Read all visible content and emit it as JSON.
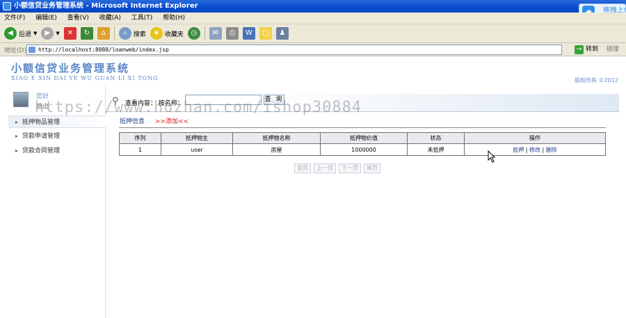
{
  "window": {
    "title": "小额信贷业务管理系统 - Microsoft Internet Explorer"
  },
  "upload_widget": {
    "label": "拖拽上传"
  },
  "menu": [
    "文件(F)",
    "编辑(E)",
    "查看(V)",
    "收藏(A)",
    "工具(T)",
    "帮助(H)"
  ],
  "toolbar": {
    "back": "后退",
    "search": "搜索",
    "favorites": "收藏夹"
  },
  "addressbar": {
    "label": "地址(D)",
    "url": "http://localhost:8088/loanweb/index.jsp",
    "go": "转到",
    "links": "链接"
  },
  "header": {
    "title": "小额信贷业务管理系统",
    "pinyin": "XIAO E XIN DAI YE WU GUAN LI XI TONG",
    "copyright": "版权所有  ©2012"
  },
  "user": {
    "greeting": "您好",
    "exit": "退出"
  },
  "sidebar": {
    "items": [
      {
        "label": "抵押物品管理"
      },
      {
        "label": "贷款申请管理"
      },
      {
        "label": "贷款合同管理"
      }
    ]
  },
  "search": {
    "label": "查看内容：  按名称：",
    "value": "",
    "button": "查 询"
  },
  "tabs": {
    "info": "抵押信息",
    "add": ">>添加<<"
  },
  "table": {
    "headers": [
      "序列",
      "抵押物主",
      "抵押物名称",
      "抵押物价值",
      "状态",
      "操作"
    ],
    "rows": [
      {
        "seq": "1",
        "owner": "user",
        "name": "房屋",
        "value": "1000000",
        "status": "未抵押",
        "act1": "抵押",
        "act2": "修改",
        "act3": "删除",
        "sep": "|"
      }
    ]
  },
  "pager": {
    "first": "首页",
    "prev": "上一页",
    "next": "下一页",
    "last": "尾页"
  },
  "watermark": "https://www.huzhan.com/ishop30884"
}
